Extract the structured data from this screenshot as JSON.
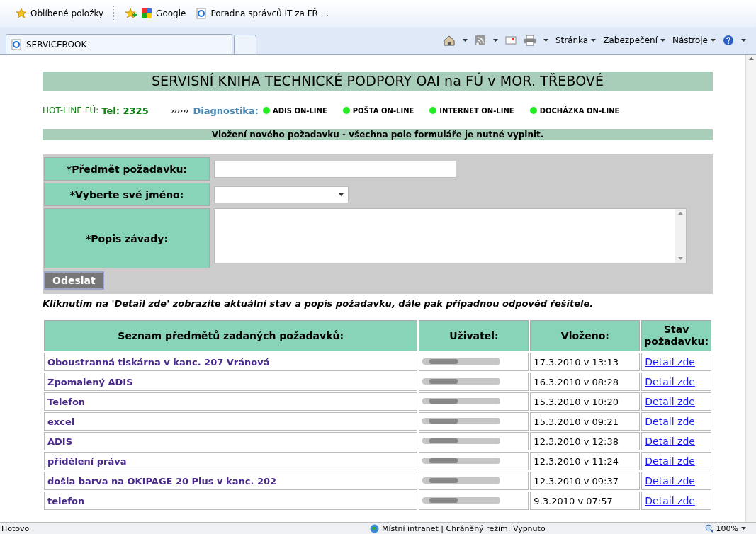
{
  "browser": {
    "favorites": [
      {
        "label": "Oblíbené položky",
        "kind": "star"
      },
      {
        "label": "Google",
        "kind": "google"
      },
      {
        "label": "Poradna správců IT za FŘ ...",
        "kind": "ie"
      }
    ],
    "tab": {
      "title": "SERVICEBOOK"
    },
    "commands": [
      "Stránka",
      "Zabezpečení",
      "Nástroje"
    ]
  },
  "page": {
    "title": "SERVISNÍ KNIHA TECHNICKÉ PODPORY OAI na FÚ v MOR. TŘEBOVÉ",
    "hotline_label": "HOT-LINE FÚ:",
    "hotline_tel": "Tel: 2325",
    "arrows": "››››››",
    "diagnostics_label": "Diagnostika:",
    "diagnostics": [
      {
        "label": "ADIS ON-LINE",
        "color": "#22ee22"
      },
      {
        "label": "POŠTA ON-LINE",
        "color": "#22ee22"
      },
      {
        "label": "INTERNET ON-LINE",
        "color": "#22ee22"
      },
      {
        "label": "DOCHÁZKA ON-LINE",
        "color": "#22ee22"
      }
    ],
    "form_heading": "Vložení nového požadavku - všechna pole formuláře je nutné vyplnit.",
    "form": {
      "fields": [
        {
          "label": "*Předmět požadavku:",
          "kind": "text"
        },
        {
          "label": "*Vyberte své jméno:",
          "kind": "select"
        },
        {
          "label": "*Popis závady:",
          "kind": "textarea"
        }
      ],
      "submit": "Odeslat"
    },
    "note": "Kliknutím na 'Detail zde' zobrazíte aktuální stav a popis požadavku, dále pak případnou odpověď řešitele.",
    "table": {
      "columns": [
        "Seznam předmětů zadaných požadavků:",
        "Uživatel:",
        "Vloženo:",
        "Stav požadavku:"
      ],
      "rows": [
        {
          "subject": "Oboustranná tiskárna v kanc. 207 Vránová",
          "inserted": "17.3.2010 v 13:13",
          "status": "Detail zde"
        },
        {
          "subject": "Zpomalený ADIS",
          "inserted": "16.3.2010 v 08:28",
          "status": "Detail zde"
        },
        {
          "subject": "Telefon",
          "inserted": "15.3.2010 v 10:20",
          "status": "Detail zde"
        },
        {
          "subject": "excel",
          "inserted": "15.3.2010 v 09:21",
          "status": "Detail zde"
        },
        {
          "subject": "ADIS",
          "inserted": "12.3.2010 v 12:38",
          "status": "Detail zde"
        },
        {
          "subject": "přidělení práva",
          "inserted": "12.3.2010 v 11:24",
          "status": "Detail zde"
        },
        {
          "subject": "došla barva na OKIPAGE 20 Plus v kanc. 202",
          "inserted": "12.3.2010 v 09:37",
          "status": "Detail zde"
        },
        {
          "subject": "telefon",
          "inserted": "9.3.2010 v 07:57",
          "status": "Detail zde"
        }
      ]
    }
  },
  "status_bar": {
    "text": "Hotovo",
    "zone": "Místní intranet | Chráněný režim: Vypnuto",
    "zoom": "100%"
  }
}
